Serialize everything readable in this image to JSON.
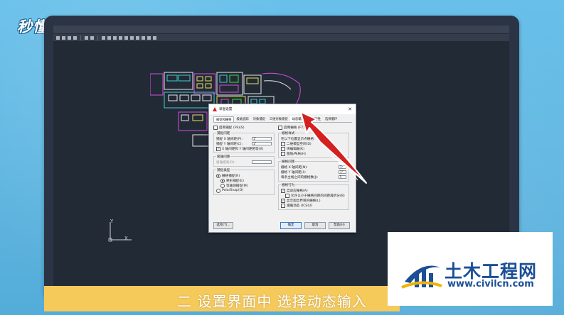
{
  "watermark": {
    "text": "秒懂视频"
  },
  "cad": {
    "menu": [
      "",
      "",
      "",
      "",
      "",
      "",
      "",
      "",
      ""
    ],
    "axis": {
      "y": "Y",
      "x": "X"
    }
  },
  "dialog": {
    "title": "草图设置",
    "tabs": [
      "捕捉和栅格",
      "极轴追踪",
      "对象捕捉",
      "三维对象捕捉",
      "动态输入",
      "快捷特性",
      "选择循环"
    ],
    "snap_enable": "启用捕捉 (F9)(S)",
    "snap_spacing_group": "捕捉间距",
    "snap_x_label": "捕捉 X 轴间距(P):",
    "snap_x_value": "1\"",
    "snap_y_label": "捕捉 Y 轴间距(C):",
    "snap_y_value": "1\"",
    "equal_xy": "X 轴间距和 Y 轴间距相等(X)",
    "polar_spacing_group": "极轴间距",
    "polar_distance_label": "极轴距离(D):",
    "polar_distance_value": "",
    "snap_type_group": "捕捉类型",
    "grid_snap": "栅格捕捉(R)",
    "rect_snap": "矩形捕捉(E)",
    "iso_snap": "等轴测捕捉(M)",
    "polar_snap": "PolarSnap(O)",
    "grid_enable": "启用栅格 (F7)(G)",
    "grid_style_group": "栅格样式",
    "grid_style_hint": "在以下位置显示点栅格:",
    "grid_2d": "二维模型空间(D)",
    "grid_block": "块编辑器(K)",
    "grid_sheet": "图纸/布局(H)",
    "grid_spacing_group": "栅格间距",
    "grid_x_label": "栅格 X 轴间距(N):",
    "grid_x_value": "1\"",
    "grid_y_label": "栅格 Y 轴间距(I):",
    "grid_y_value": "1\"",
    "major_label": "每条主线之间的栅格数(J):",
    "major_value": "5",
    "grid_behavior_group": "栅格行为",
    "adaptive": "自适应栅格(A)",
    "subdivide": "允许以小于栅格间距的间距再拆分(B)",
    "beyond_limits": "显示超出界限的栅格(L)",
    "follow_ucs": "遵循动态 UCS(U)",
    "options_btn": "选项(T)...",
    "ok_btn": "确定",
    "cancel_btn": "取消",
    "help_btn": "帮助(H)"
  },
  "subtitle": {
    "text": "二 设置界面中 选择动态输入"
  },
  "logo": {
    "title": "土木工程网",
    "url": "www.civilcn.com"
  },
  "colors": {
    "accent_arrow": "#d42020",
    "subtitle_bg": "#f6c95b",
    "logo_blue": "#1b4f96"
  }
}
